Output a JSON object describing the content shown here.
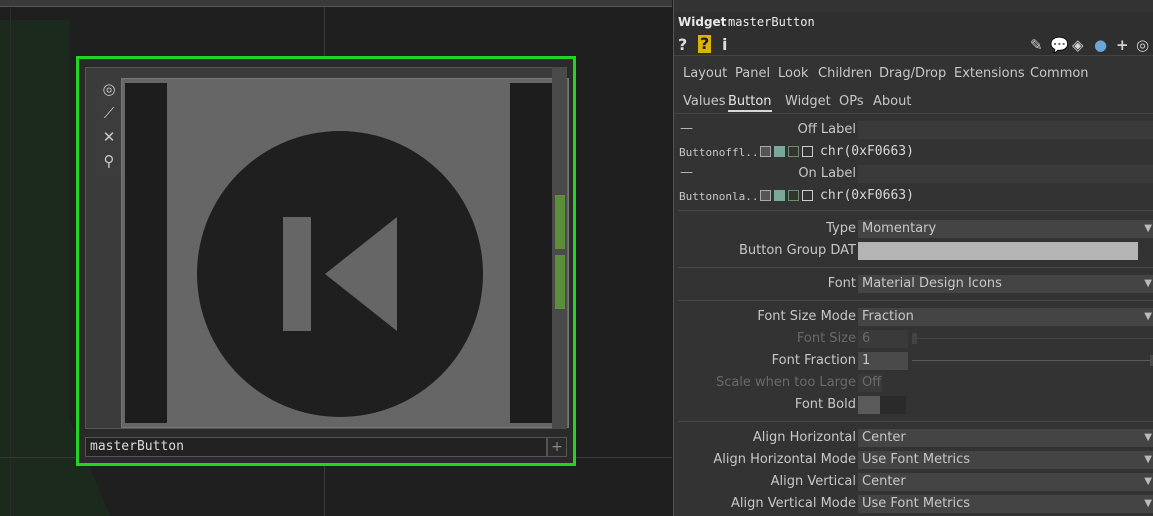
{
  "node": {
    "label": "masterButton",
    "plus_icon": "+",
    "toolbar_icons": [
      "target-icon",
      "bypass-icon",
      "close-icon",
      "lock-icon"
    ]
  },
  "panel": {
    "op_type": "Widget",
    "op_name": "masterButton",
    "help_icons": [
      "?",
      "?",
      "i"
    ],
    "page_tabs": [
      "Layout",
      "Panel",
      "Look",
      "Children",
      "Drag/Drop",
      "Extensions",
      "Common"
    ],
    "sub_tabs": [
      "Values",
      "Button",
      "Widget",
      "OPs",
      "About"
    ],
    "active_sub_tab": "Button",
    "off_label": {
      "label": "Off Label",
      "seq_name": "Buttonoffl..",
      "value": "chr(0xF0663)"
    },
    "on_label": {
      "label": "On Label",
      "seq_name": "Buttononla..",
      "value": "chr(0xF0663)"
    },
    "params": {
      "type": {
        "label": "Type",
        "value": "Momentary"
      },
      "button_group_dat": {
        "label": "Button Group DAT",
        "value": ""
      },
      "font": {
        "label": "Font",
        "value": "Material Design Icons"
      },
      "font_size_mode": {
        "label": "Font Size Mode",
        "value": "Fraction"
      },
      "font_size": {
        "label": "Font Size",
        "value": "6"
      },
      "font_fraction": {
        "label": "Font Fraction",
        "value": "1"
      },
      "scale_when_too_large": {
        "label": "Scale when too Large",
        "value": "Off"
      },
      "font_bold": {
        "label": "Font Bold",
        "value": "On"
      },
      "align_horizontal": {
        "label": "Align Horizontal",
        "value": "Center"
      },
      "align_horizontal_mode": {
        "label": "Align Horizontal Mode",
        "value": "Use Font Metrics"
      },
      "align_vertical": {
        "label": "Align Vertical",
        "value": "Center"
      },
      "align_vertical_mode": {
        "label": "Align Vertical Mode",
        "value": "Use Font Metrics"
      }
    }
  },
  "colors": {
    "selection": "#22d522",
    "panel_bg": "#333333",
    "field_bg": "#444444"
  }
}
